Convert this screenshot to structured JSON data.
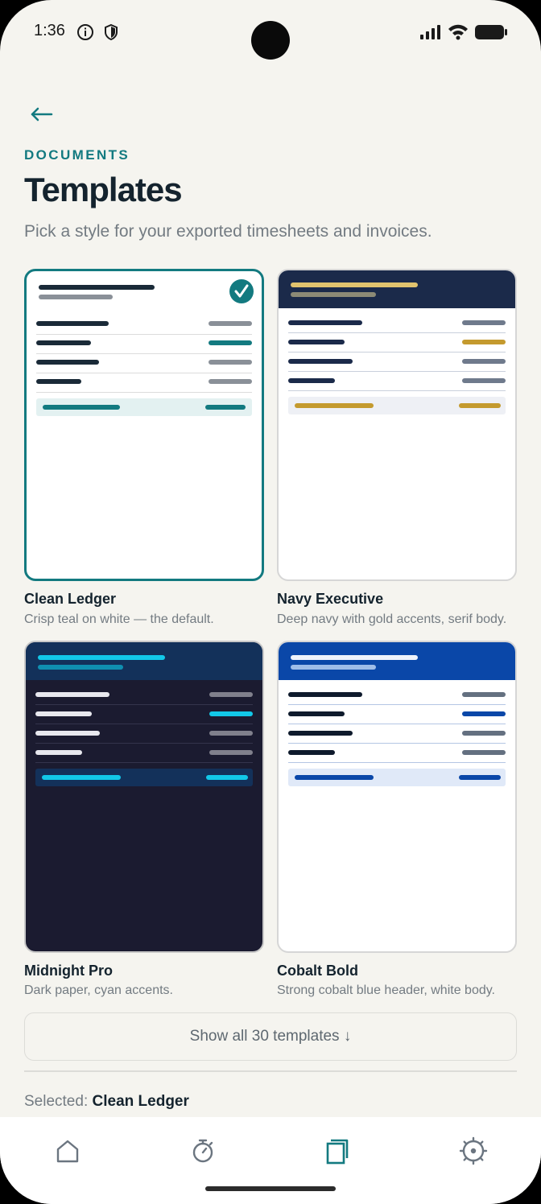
{
  "status_bar": {
    "time": "1:36"
  },
  "header": {
    "eyebrow": "DOCUMENTS",
    "title": "Templates",
    "subtitle": "Pick a style for your exported timesheets and invoices."
  },
  "templates": [
    {
      "name": "Clean Ledger",
      "description": "Crisp teal on white — the default.",
      "selected": true
    },
    {
      "name": "Navy Executive",
      "description": "Deep navy with gold accents, serif body.",
      "selected": false
    },
    {
      "name": "Midnight Pro",
      "description": "Dark paper, cyan accents.",
      "selected": false
    },
    {
      "name": "Cobalt Bold",
      "description": "Strong cobalt blue header, white body.",
      "selected": false
    }
  ],
  "show_all_label": "Show all 30 templates ↓",
  "selection": {
    "prefix": "Selected:",
    "value": "Clean Ledger"
  },
  "nav": {
    "items": [
      {
        "icon": "home-icon",
        "active": false
      },
      {
        "icon": "stopwatch-icon",
        "active": false
      },
      {
        "icon": "templates-icon",
        "active": true
      },
      {
        "icon": "settings-icon",
        "active": false
      }
    ]
  },
  "colors": {
    "accent": "#137a80",
    "navy": "#1b2a4a",
    "gold": "#c49a2e",
    "midnight": "#1b1b30",
    "cyan": "#12c8e8",
    "cobalt": "#0a47a8"
  }
}
